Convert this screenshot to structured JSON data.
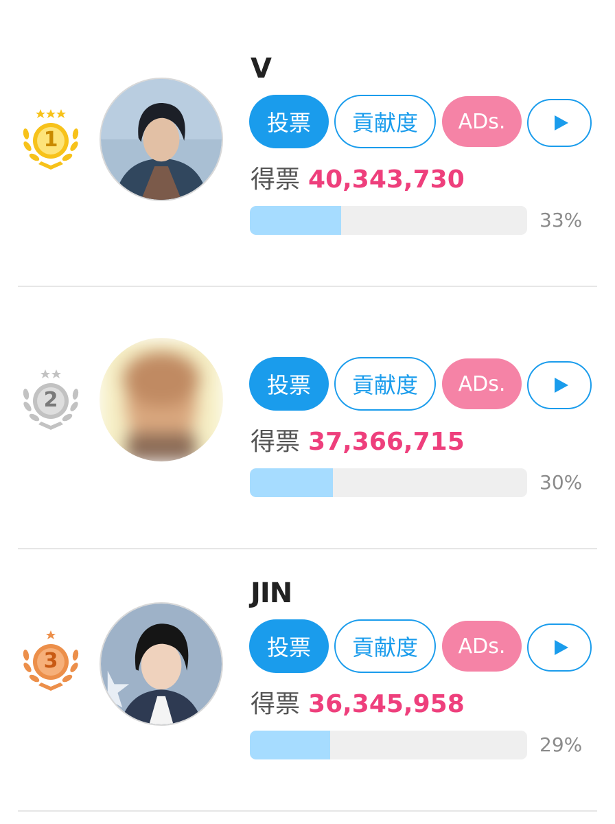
{
  "ranking": [
    {
      "rank": "1",
      "medal": "gold-medal-icon",
      "stars": 3,
      "name": "V",
      "vote_label": "投票",
      "contribution_label": "貢献度",
      "ads_label": "ADs.",
      "votes_label": "得票",
      "votes": "40,343,730",
      "percent": "33%",
      "share": 0.33
    },
    {
      "rank": "2",
      "medal": "silver-medal-icon",
      "stars": 2,
      "name": "",
      "vote_label": "投票",
      "contribution_label": "貢献度",
      "ads_label": "ADs.",
      "votes_label": "得票",
      "votes": "37,366,715",
      "percent": "30%",
      "share": 0.3
    },
    {
      "rank": "3",
      "medal": "bronze-medal-icon",
      "stars": 1,
      "name": "JIN",
      "vote_label": "投票",
      "contribution_label": "貢献度",
      "ads_label": "ADs.",
      "votes_label": "得票",
      "votes": "36,345,958",
      "percent": "29%",
      "share": 0.29
    }
  ],
  "colors": {
    "primary": "#1a9cec",
    "ads": "#f583a6",
    "votes": "#ee3f7c",
    "bar_fill": "#a6dcff",
    "gold": "#f7c21a",
    "silver": "#c2c2c2",
    "bronze": "#ec8f4a"
  }
}
